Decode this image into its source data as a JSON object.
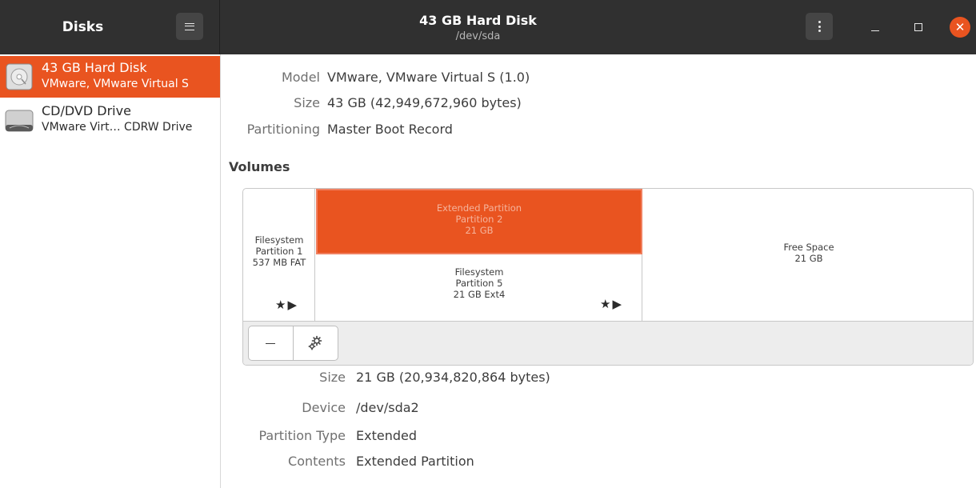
{
  "header": {
    "app_title": "Disks",
    "window_title": "43 GB Hard Disk",
    "window_subtitle": "/dev/sda",
    "close_glyph": "✕"
  },
  "sidebar": {
    "items": [
      {
        "name": "43 GB Hard Disk",
        "description": "VMware, VMware Virtual S",
        "icon": "hard-disk-icon",
        "selected": true
      },
      {
        "name": "CD/DVD Drive",
        "description": "VMware Virt… CDRW Drive",
        "icon": "optical-drive-icon",
        "selected": false
      }
    ]
  },
  "disk": {
    "model_label": "Model",
    "model_value": "VMware, VMware Virtual S (1.0)",
    "size_label": "Size",
    "size_value": "43 GB (42,949,672,960 bytes)",
    "partitioning_label": "Partitioning",
    "partitioning_value": "Master Boot Record"
  },
  "volumes": {
    "title": "Volumes",
    "partition1": {
      "line1": "Filesystem",
      "line2": "Partition 1",
      "line3": "537 MB FAT"
    },
    "extended": {
      "line1": "Extended Partition",
      "line2": "Partition 2",
      "line3": "21 GB"
    },
    "partition5": {
      "line1": "Filesystem",
      "line2": "Partition 5",
      "line3": "21 GB Ext4"
    },
    "free": {
      "line1": "Free Space",
      "line2": "21 GB"
    },
    "marks": "★▶"
  },
  "colors": {
    "accent": "#e95420",
    "header": "#303030"
  },
  "details": {
    "size_label": "Size",
    "size_value": "21 GB (20,934,820,864 bytes)",
    "device_label": "Device",
    "device_value": "/dev/sda2",
    "ptype_label": "Partition Type",
    "ptype_value": "Extended",
    "contents_label": "Contents",
    "contents_value": "Extended Partition"
  }
}
